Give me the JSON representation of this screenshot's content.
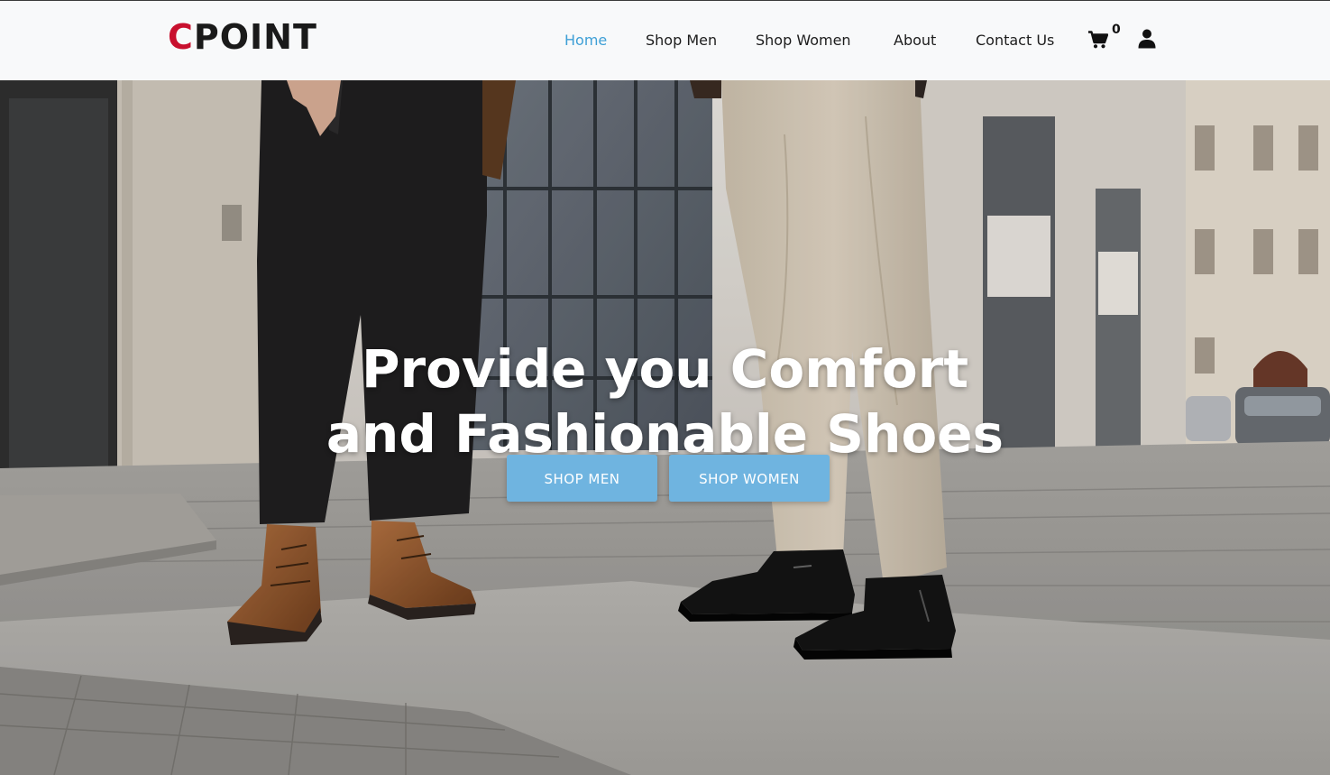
{
  "brand": {
    "logo_first_letter": "C",
    "logo_rest": "POINT",
    "accent_color": "#c8102e"
  },
  "nav": {
    "items": [
      {
        "label": "Home",
        "active": true
      },
      {
        "label": "Shop Men",
        "active": false
      },
      {
        "label": "Shop Women",
        "active": false
      },
      {
        "label": "About",
        "active": false
      },
      {
        "label": "Contact Us",
        "active": false
      }
    ],
    "active_color": "#3e9fd6",
    "cart_icon": "shopping-cart-icon",
    "cart_count": "0",
    "user_icon": "user-icon"
  },
  "hero": {
    "title_line1": "Provide you Comfort",
    "title_line2": "and Fashionable Shoes",
    "buttons": {
      "shop_men": "SHOP MEN",
      "shop_women": "SHOP WOMEN"
    },
    "button_color": "#6fb4e0"
  }
}
